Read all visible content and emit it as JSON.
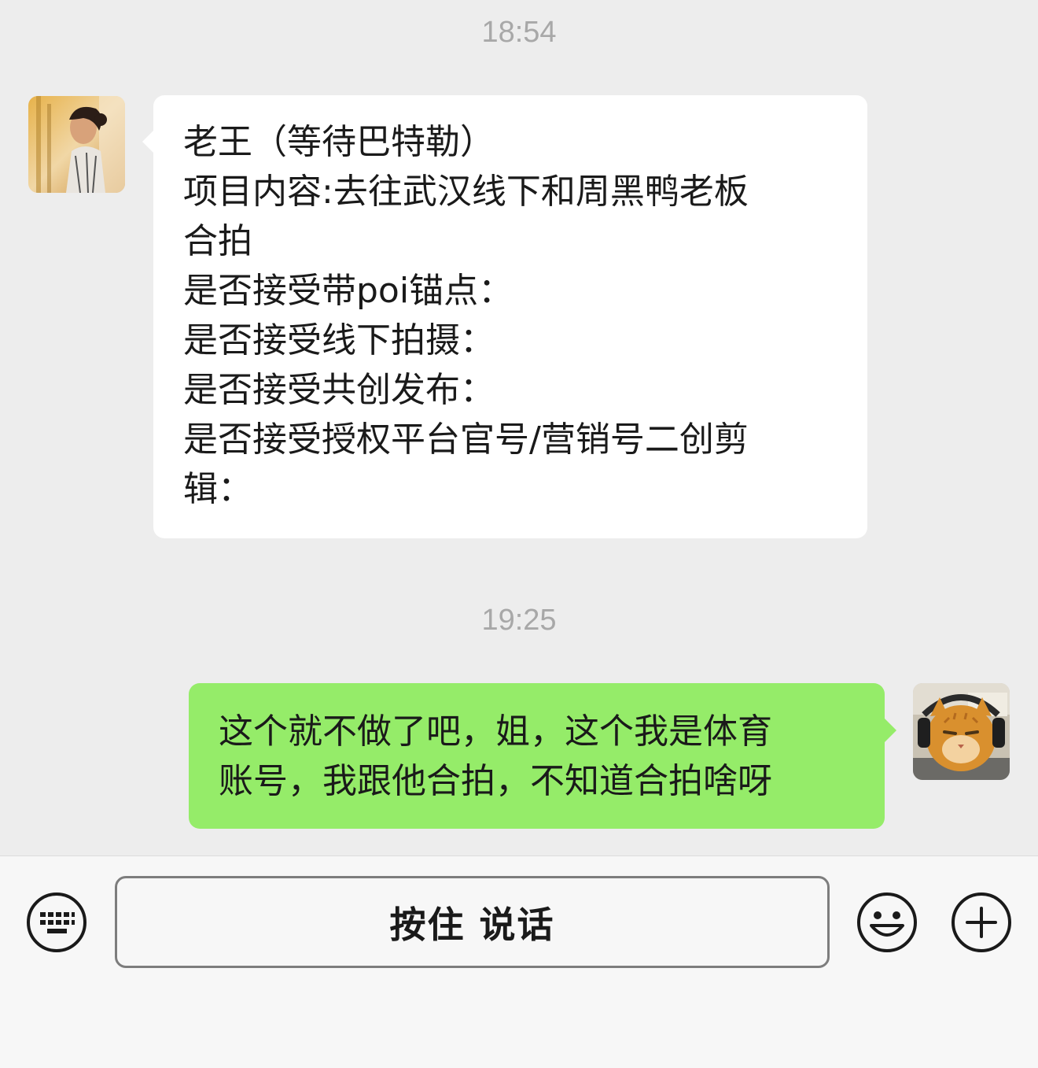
{
  "messages": [
    {
      "timestamp": "18:54",
      "direction": "incoming",
      "avatar": "woman-photo-avatar",
      "lines": [
        "老王（等待巴特勒）",
        "项目内容:去往武汉线下和周黑鸭老板",
        "合拍",
        "是否接受带poi锚点：",
        "是否接受线下拍摄：",
        "是否接受共创发布：",
        "是否接受授权平台官号/营销号二创剪",
        "辑："
      ]
    },
    {
      "timestamp": "19:25",
      "direction": "outgoing",
      "avatar": "cat-with-headphones-avatar",
      "lines": [
        "这个就不做了吧，姐，这个我是体育",
        "账号，我跟他合拍，不知道合拍啥呀"
      ]
    }
  ],
  "input_bar": {
    "talk_button_label": "按住 说话",
    "left_icon": "keyboard-icon",
    "right_icons": [
      "emoji-icon",
      "plus-icon"
    ]
  },
  "colors": {
    "background": "#ededed",
    "incoming_bubble": "#ffffff",
    "outgoing_bubble": "#95ec69",
    "timestamp_text": "#a8a8a8"
  }
}
